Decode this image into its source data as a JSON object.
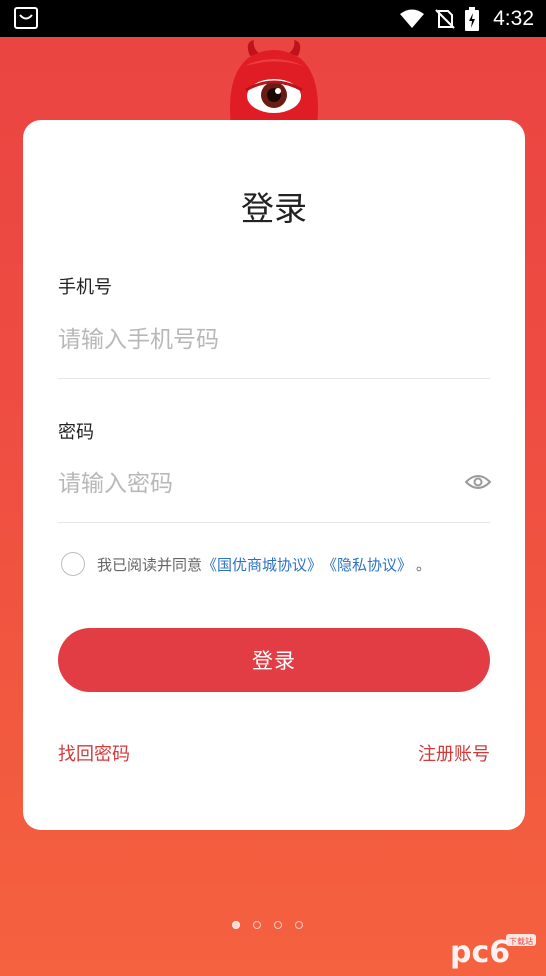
{
  "status_bar": {
    "time": "4:32",
    "icons": [
      "notification-bag-icon",
      "wifi-icon",
      "no-sim-icon",
      "battery-charging-icon"
    ]
  },
  "card": {
    "title": "登录",
    "phone": {
      "label": "手机号",
      "placeholder": "请输入手机号码",
      "value": ""
    },
    "password": {
      "label": "密码",
      "placeholder": "请输入密码",
      "value": "",
      "toggle_icon": "eye-icon"
    },
    "agreement": {
      "checked": false,
      "prefix": "我已阅读并同意",
      "link1": "《国优商城协议》",
      "link2": "《隐私协议》",
      "suffix": "。"
    },
    "login_button": "登录",
    "forgot_password": "找回密码",
    "register": "注册账号"
  },
  "pager": {
    "count": 4,
    "active_index": 0
  },
  "watermark": {
    "text": "pc6",
    "subtext": "下载站"
  },
  "colors": {
    "accent": "#e23c45",
    "link": "#2d73c3",
    "bottom_link": "#d33a3a",
    "background_top": "#ea4441",
    "background_bottom": "#f5623f"
  }
}
